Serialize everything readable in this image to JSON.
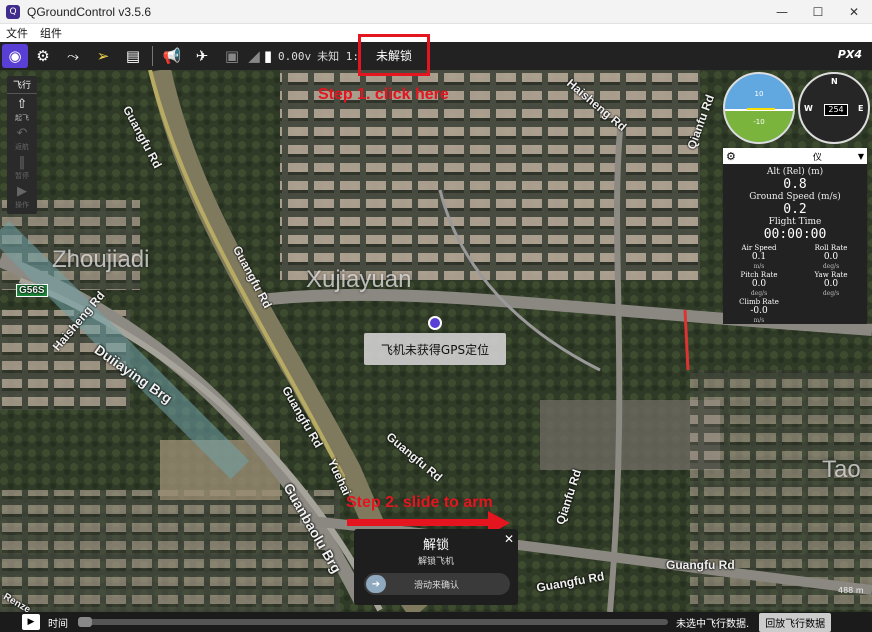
{
  "window": {
    "title": "QGroundControl v3.5.6",
    "minimize": "—",
    "maximize": "☐",
    "close": "✕"
  },
  "menu": {
    "file": "文件",
    "widgets": "组件"
  },
  "toolbar": {
    "battery": "0.00v",
    "gps": "未知 1:",
    "arm_status": "未解锁",
    "logo": "PX4"
  },
  "fly_panel": {
    "title": "飞行",
    "takeoff": "起飞",
    "land": "返航",
    "pause": "暂停",
    "action": "操作"
  },
  "instruments": {
    "pitch_up": "10",
    "pitch_down": "-10",
    "pitch_up2": "10",
    "pitch_down2": "-10",
    "north": "N",
    "west": "W",
    "east": "E",
    "heading": "254"
  },
  "telemetry": {
    "selector": "仪",
    "alt_label": "Alt (Rel) (m)",
    "alt_value": "0.8",
    "gs_label": "Ground Speed (m/s)",
    "gs_value": "0.2",
    "ft_label": "Flight Time",
    "ft_value": "00:00:00",
    "cells": [
      {
        "name": "Air Speed",
        "value": "0.1",
        "unit": "m/s"
      },
      {
        "name": "Roll Rate",
        "value": "0.0",
        "unit": "deg/s"
      },
      {
        "name": "Pitch Rate",
        "value": "0.0",
        "unit": "deg/s"
      },
      {
        "name": "Yaw Rate",
        "value": "0.0",
        "unit": "deg/s"
      },
      {
        "name": "Climb Rate",
        "value": "-0.0",
        "unit": "m/s"
      }
    ]
  },
  "map": {
    "areas": [
      "Zhoujiadi",
      "Xujiayuan",
      "Tao"
    ],
    "roads": [
      "Guangfu Rd",
      "Guangfu Rd",
      "Guangfu Rd",
      "Guangfu Rd",
      "Guangfu Rd",
      "Qianfu Rd",
      "Qianfu Rd",
      "Haisheng Rd",
      "Haisheng Rd",
      "Duiiaying Brg",
      "Guanbaolu Brg",
      "Yuehai",
      "Guangfu Rd",
      "Renze"
    ],
    "highway": "G56S",
    "gps_notice": "飞机未获得GPS定位",
    "scale": "488 m"
  },
  "annotations": {
    "step1": "Step 1. click here",
    "step2": "Step 2. slide to arm"
  },
  "arm_dialog": {
    "title": "解锁",
    "subtitle": "解锁飞机",
    "slider_text": "滑动来确认",
    "close": "✕"
  },
  "bottombar": {
    "play": "▶",
    "time": "时间",
    "no_data": "未选中飞行数据.",
    "play_log": "回放飞行数据"
  }
}
